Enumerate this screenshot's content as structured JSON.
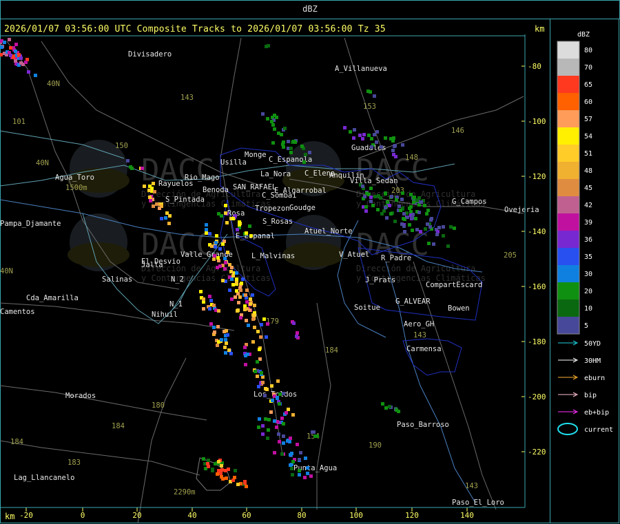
{
  "window": {
    "title": "dBZ"
  },
  "header": {
    "title": "2026/01/07 03:56:00 UTC Composite Tracks to 2026/01/07 03:56:00 Tz 35",
    "unit_top": "km",
    "unit_bottom": "km"
  },
  "axes": {
    "x_ticks": [
      "-20",
      "0",
      "20",
      "40",
      "60",
      "80",
      "100",
      "120",
      "140"
    ],
    "y_ticks": [
      "-80",
      "-100",
      "-120",
      "-140",
      "-160",
      "-180",
      "-200",
      "-220"
    ]
  },
  "places": [
    "Divisadero",
    "A_Villanueva",
    "40N",
    "101",
    "143",
    "153",
    "146",
    "150",
    "40N",
    "Agua_Toro",
    "1500m",
    "Usilla",
    "Monge",
    "C_Espanola",
    "C_Elena",
    "Anquilin",
    "Villa_Sedan",
    "Guadales",
    "148",
    "203",
    "G_Campos",
    "Ovejeria",
    "Rayuelos",
    "Rio_Mago",
    "S_Pintada",
    "Benoda",
    "SAN_RAFAEL",
    "E_Algarrobal",
    "C_Sombai",
    "Rosa",
    "Tropezon",
    "Goudge",
    "La_Nora",
    "S_Rosas",
    "Atuel_Norte",
    "Pampa_Djamante",
    "Jalla",
    "El_Desvio",
    "Valle_Grande",
    "E_Espanal",
    "L_Malvinas",
    "V_Atuel",
    "R_Padre",
    "J_Prats",
    "CompartEscard",
    "Salinas",
    "N_2",
    "N_1",
    "Nihuil",
    "G_ALVEAR",
    "Bowen",
    "Soitue",
    "Aero_GH",
    "Cda_Amarilla",
    "Camentos",
    "Carmensa",
    "143",
    "184",
    "179",
    "Morados",
    "180",
    "184",
    "Los_Toldos",
    "Paso_Barroso",
    "184",
    "183",
    "190",
    "Punta_Agua",
    "Lag_Llancanelo",
    "2290m",
    "143",
    "Paso_El_Loro",
    "205",
    "40N",
    "154"
  ],
  "watermark": {
    "brand": "DACC",
    "line1": "Dirección de Agricultura",
    "line2": "y Contingencias Climáticas"
  },
  "legend": {
    "title": "dBZ",
    "levels": [
      {
        "label": "80",
        "color": "#dcdcdc"
      },
      {
        "label": "70",
        "color": "#b8b8b8"
      },
      {
        "label": "65",
        "color": "#ff3820"
      },
      {
        "label": "60",
        "color": "#ff6000"
      },
      {
        "label": "57",
        "color": "#ff9c5a"
      },
      {
        "label": "54",
        "color": "#fff000"
      },
      {
        "label": "51",
        "color": "#ffcc28"
      },
      {
        "label": "48",
        "color": "#f0b030"
      },
      {
        "label": "45",
        "color": "#e08c40"
      },
      {
        "label": "42",
        "color": "#c06090"
      },
      {
        "label": "39",
        "color": "#c010a0"
      },
      {
        "label": "36",
        "color": "#7828d0"
      },
      {
        "label": "35",
        "color": "#2850f0"
      },
      {
        "label": "30",
        "color": "#1080e0"
      },
      {
        "label": "20",
        "color": "#109010"
      },
      {
        "label": "10",
        "color": "#0a6810"
      },
      {
        "label": "5",
        "color": "#48489a"
      }
    ],
    "tracks": [
      {
        "label": "50YD",
        "color": "#20d0e0"
      },
      {
        "label": "30HM",
        "color": "#ffffff"
      },
      {
        "label": "eburn",
        "color": "#ffb030"
      },
      {
        "label": "bip",
        "color": "#ffc0d0"
      },
      {
        "label": "eb+bip",
        "color": "#ff30ff"
      },
      {
        "label": "current",
        "color": "#20e0f0"
      }
    ]
  }
}
